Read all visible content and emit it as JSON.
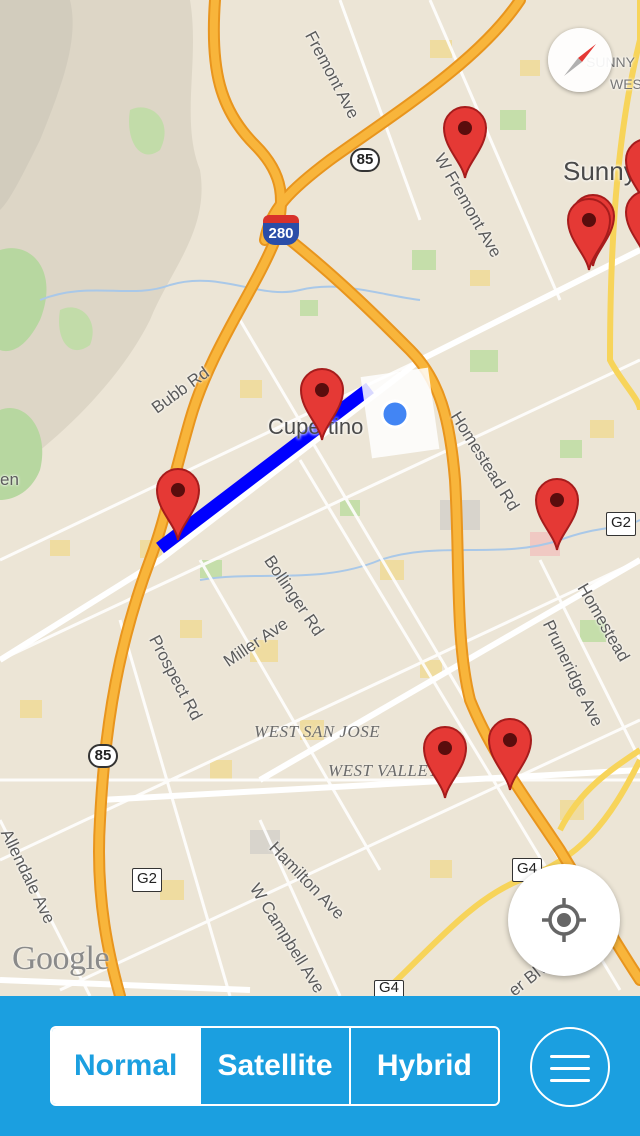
{
  "map": {
    "labels": {
      "fremont_ave": "Fremont Ave",
      "w_fremont_ave": "W Fremont Ave",
      "homestead_rd": "Homestead Rd",
      "homestead_right": "Homestead",
      "bubb_rd": "Bubb Rd",
      "bollinger_rd": "Bollinger Rd",
      "miller_ave": "Miller Ave",
      "prospect_rd": "Prospect Rd",
      "pruneridge_ave": "Pruneridge Ave",
      "hamilton_ave": "Hamilton Ave",
      "w_campbell_ave": "W Campbell Ave",
      "allendale_ave": "Allendale Ave",
      "er_blvd": "er Blvd",
      "en": "en"
    },
    "cities": {
      "cupertino": "Cupertino",
      "sunnyvale": "Sunny",
      "sunny_small": "SUNNY",
      "wes_small": "WES"
    },
    "areas": {
      "west_san_jose": "WEST SAN JOSE",
      "west_valley": "WEST VALLEY"
    },
    "shields": {
      "hwy85_top": "85",
      "hwy85_bottom": "85",
      "i280": "280",
      "g2_right": "G2",
      "g2_left": "G2",
      "g4_a": "G4",
      "g4_b": "G4"
    },
    "attribution": "Google"
  },
  "toolbar": {
    "map_types": [
      "Normal",
      "Satellite",
      "Hybrid"
    ],
    "selected_type": "Normal"
  },
  "colors": {
    "accent": "#1b9fe0",
    "highway": "#f5a623",
    "route": "#0000ff",
    "pin": "#e53935",
    "location_dot": "#4285f4"
  },
  "icons": {
    "compass": "compass-icon",
    "locate": "crosshair-icon",
    "menu": "hamburger-icon",
    "pin": "map-pin-icon"
  }
}
